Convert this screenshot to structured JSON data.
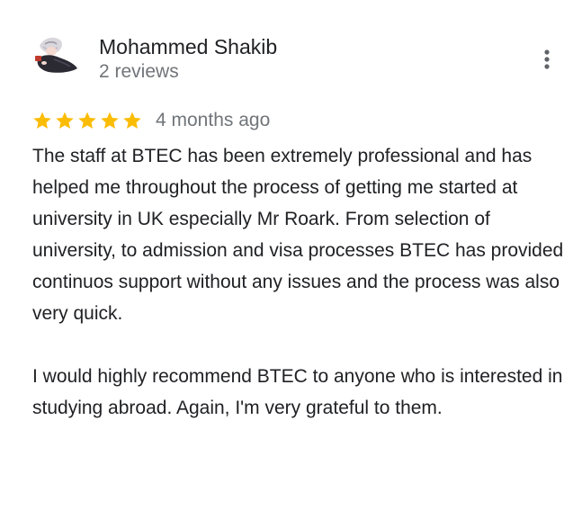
{
  "reviewer": {
    "name": "Mohammed Shakib",
    "review_count": "2 reviews"
  },
  "review": {
    "rating": 5,
    "rating_max": 5,
    "date": "4 months ago",
    "paragraphs": [
      "The staff at BTEC has been extremely professional and has helped me throughout the process of getting me started at university in UK especially Mr Roark. From selection of university, to admission and visa processes BTEC has provided continuos support without any issues and the process was also very quick.",
      "I would highly recommend BTEC to anyone who is interested in studying abroad. Again, I'm very grateful to them."
    ]
  },
  "icons": {
    "more": "more-vert-icon",
    "star": "star-icon",
    "avatar": "profile-photo"
  },
  "colors": {
    "star": "#fbbc04",
    "secondary_text": "#70757a",
    "primary_text": "#202124"
  }
}
